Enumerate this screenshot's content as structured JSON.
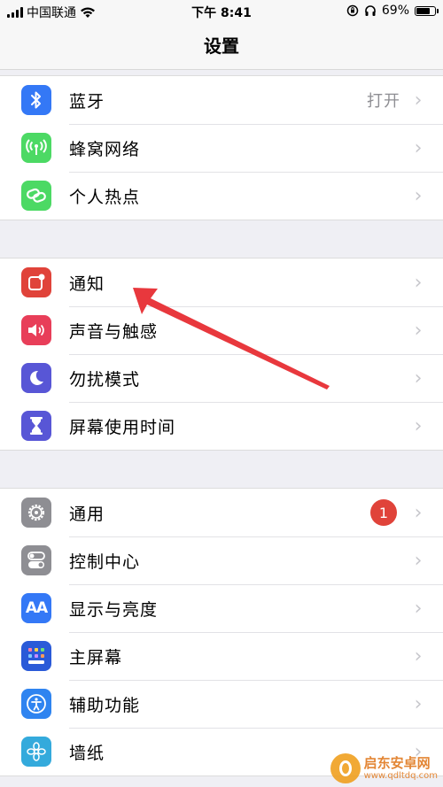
{
  "status_bar": {
    "carrier": "中国联通",
    "time": "下午 8:41",
    "battery_percent_text": "69%",
    "battery_level": 0.69
  },
  "nav": {
    "title": "设置"
  },
  "groups": [
    {
      "rows": [
        {
          "label": "蓝牙",
          "detail": "打开",
          "icon": "bluetooth-icon",
          "color": "#3478f6"
        },
        {
          "label": "蜂窝网络",
          "icon": "cellular-antenna-icon",
          "color": "#4cd964"
        },
        {
          "label": "个人热点",
          "icon": "hotspot-link-icon",
          "color": "#4cd964"
        }
      ]
    },
    {
      "rows": [
        {
          "label": "通知",
          "icon": "notifications-icon",
          "color": "#e0433a"
        },
        {
          "label": "声音与触感",
          "icon": "speaker-icon",
          "color": "#e83e59"
        },
        {
          "label": "勿扰模式",
          "icon": "moon-icon",
          "color": "#5856d6"
        },
        {
          "label": "屏幕使用时间",
          "icon": "hourglass-icon",
          "color": "#5856d6"
        }
      ]
    },
    {
      "rows": [
        {
          "label": "通用",
          "badge": "1",
          "icon": "gear-icon",
          "color": "#8e8e93"
        },
        {
          "label": "控制中心",
          "icon": "toggles-icon",
          "color": "#8e8e93"
        },
        {
          "label": "显示与亮度",
          "icon_text": "AA",
          "icon": "text-size-icon",
          "color": "#3478f6"
        },
        {
          "label": "主屏幕",
          "icon": "home-grid-icon",
          "color": "#2a5ad8"
        },
        {
          "label": "辅助功能",
          "icon": "accessibility-icon",
          "color": "#2f84f0"
        },
        {
          "label": "墙纸",
          "icon": "flower-icon",
          "color": "#34aadc"
        }
      ]
    }
  ],
  "watermark": {
    "title": "启东安卓网",
    "url": "www.qdltdq.com"
  },
  "colors": {
    "arrow": "#e8383d",
    "background": "#efeff4"
  }
}
